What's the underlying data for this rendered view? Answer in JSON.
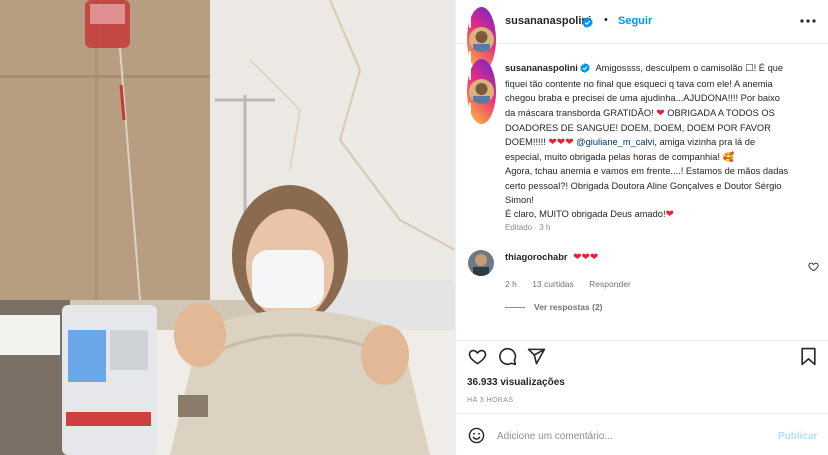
{
  "post": {
    "author": "susananaspolini",
    "follow_label": "Seguir",
    "header_separator": "•",
    "more_icon": "more-horizontal-icon",
    "verified_icon": "verified-badge-icon"
  },
  "caption": {
    "author": "susananaspolini",
    "lines": [
      "Amigossss, desculpem o camisolão ☐! É que",
      "fiquei tão contente no final que esqueci q tava com ele! A anemia",
      "chegou braba e precisei de uma ajudinha...AJUDONA!!!! Por baixo",
      "da máscara transborda GRATIDÃO!",
      "OBRIGADA A TODOS OS",
      "DOADORES DE SANGUE! DOEM, DOEM, DOEM POR FAVOR",
      "DOEM!!!!!",
      "@giuliane_m_calvi",
      ", amiga vizinha pra lá de",
      "especial, muito obrigada pelas horas de companhia!",
      "Agora, tchau anemia e vamos em frente....! Estamos de mãos dadas",
      "certo pessoal?! Obrigada Doutora Aline Gonçalves e Doutor Sérgio",
      "Simon!",
      "É claro, MUITO obrigada Deus amado!"
    ],
    "heart_glyph": "❤",
    "smile_glyph": "🥰",
    "edited_label": "Editado",
    "edited_time": "3 h",
    "meta_separator": "·"
  },
  "comment": {
    "author": "thiagorochabr",
    "text": "❤❤❤",
    "time": "2 h",
    "likes": "13 curtidas",
    "reply_label": "Responder",
    "view_replies": "Ver respostas (2)",
    "like_icon": "heart-outline-icon"
  },
  "actions": {
    "views": "36.933 visualizações",
    "time_ago": "HÁ 3 HORAS",
    "like_icon": "heart-outline-icon",
    "comment_icon": "comment-bubble-icon",
    "share_icon": "paper-plane-icon",
    "save_icon": "bookmark-icon"
  },
  "add_comment": {
    "placeholder": "Adicione um comentário...",
    "publish_label": "Publicar",
    "emoji_icon": "emoji-smiley-icon"
  },
  "colors": {
    "link_blue": "#0095f6",
    "mention": "#00376b",
    "heart_red": "#ed1f35",
    "muted": "#8e8e8e"
  }
}
